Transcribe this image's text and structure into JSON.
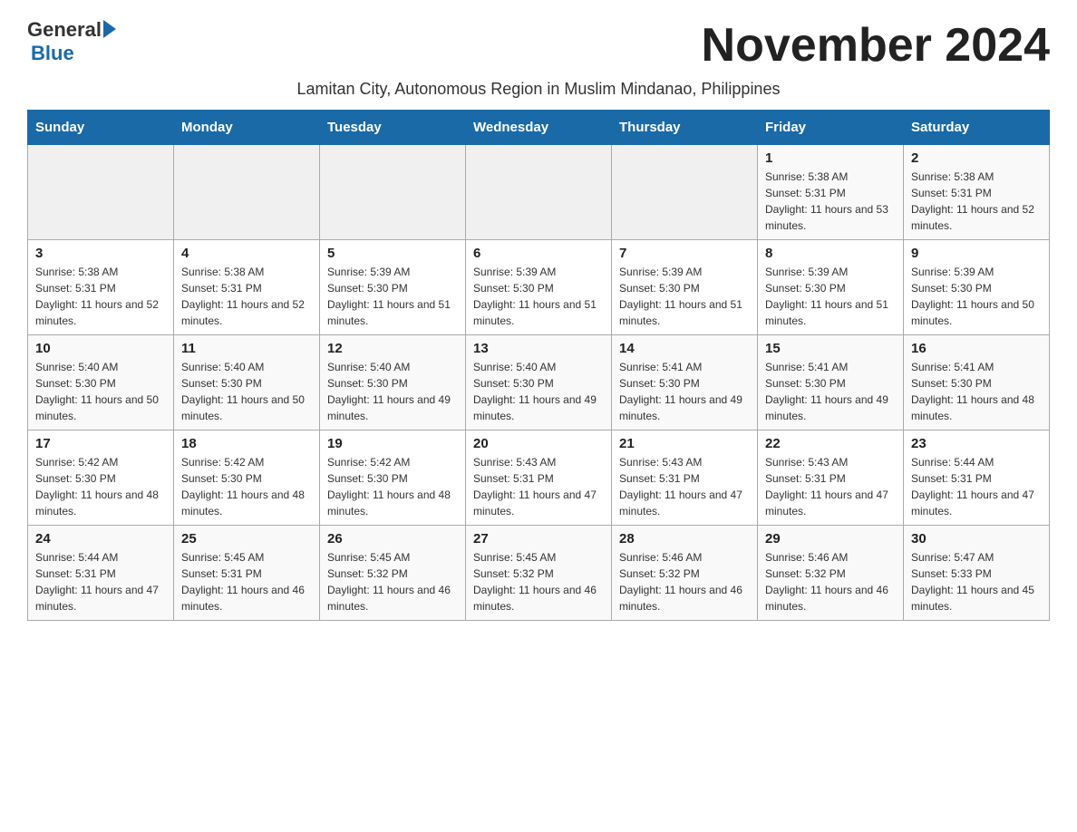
{
  "header": {
    "title": "November 2024",
    "subtitle": "Lamitan City, Autonomous Region in Muslim Mindanao, Philippines",
    "logo_general": "General",
    "logo_blue": "Blue"
  },
  "days_of_week": [
    "Sunday",
    "Monday",
    "Tuesday",
    "Wednesday",
    "Thursday",
    "Friday",
    "Saturday"
  ],
  "weeks": [
    [
      {
        "day": "",
        "sunrise": "",
        "sunset": "",
        "daylight": ""
      },
      {
        "day": "",
        "sunrise": "",
        "sunset": "",
        "daylight": ""
      },
      {
        "day": "",
        "sunrise": "",
        "sunset": "",
        "daylight": ""
      },
      {
        "day": "",
        "sunrise": "",
        "sunset": "",
        "daylight": ""
      },
      {
        "day": "",
        "sunrise": "",
        "sunset": "",
        "daylight": ""
      },
      {
        "day": "1",
        "sunrise": "Sunrise: 5:38 AM",
        "sunset": "Sunset: 5:31 PM",
        "daylight": "Daylight: 11 hours and 53 minutes."
      },
      {
        "day": "2",
        "sunrise": "Sunrise: 5:38 AM",
        "sunset": "Sunset: 5:31 PM",
        "daylight": "Daylight: 11 hours and 52 minutes."
      }
    ],
    [
      {
        "day": "3",
        "sunrise": "Sunrise: 5:38 AM",
        "sunset": "Sunset: 5:31 PM",
        "daylight": "Daylight: 11 hours and 52 minutes."
      },
      {
        "day": "4",
        "sunrise": "Sunrise: 5:38 AM",
        "sunset": "Sunset: 5:31 PM",
        "daylight": "Daylight: 11 hours and 52 minutes."
      },
      {
        "day": "5",
        "sunrise": "Sunrise: 5:39 AM",
        "sunset": "Sunset: 5:30 PM",
        "daylight": "Daylight: 11 hours and 51 minutes."
      },
      {
        "day": "6",
        "sunrise": "Sunrise: 5:39 AM",
        "sunset": "Sunset: 5:30 PM",
        "daylight": "Daylight: 11 hours and 51 minutes."
      },
      {
        "day": "7",
        "sunrise": "Sunrise: 5:39 AM",
        "sunset": "Sunset: 5:30 PM",
        "daylight": "Daylight: 11 hours and 51 minutes."
      },
      {
        "day": "8",
        "sunrise": "Sunrise: 5:39 AM",
        "sunset": "Sunset: 5:30 PM",
        "daylight": "Daylight: 11 hours and 51 minutes."
      },
      {
        "day": "9",
        "sunrise": "Sunrise: 5:39 AM",
        "sunset": "Sunset: 5:30 PM",
        "daylight": "Daylight: 11 hours and 50 minutes."
      }
    ],
    [
      {
        "day": "10",
        "sunrise": "Sunrise: 5:40 AM",
        "sunset": "Sunset: 5:30 PM",
        "daylight": "Daylight: 11 hours and 50 minutes."
      },
      {
        "day": "11",
        "sunrise": "Sunrise: 5:40 AM",
        "sunset": "Sunset: 5:30 PM",
        "daylight": "Daylight: 11 hours and 50 minutes."
      },
      {
        "day": "12",
        "sunrise": "Sunrise: 5:40 AM",
        "sunset": "Sunset: 5:30 PM",
        "daylight": "Daylight: 11 hours and 49 minutes."
      },
      {
        "day": "13",
        "sunrise": "Sunrise: 5:40 AM",
        "sunset": "Sunset: 5:30 PM",
        "daylight": "Daylight: 11 hours and 49 minutes."
      },
      {
        "day": "14",
        "sunrise": "Sunrise: 5:41 AM",
        "sunset": "Sunset: 5:30 PM",
        "daylight": "Daylight: 11 hours and 49 minutes."
      },
      {
        "day": "15",
        "sunrise": "Sunrise: 5:41 AM",
        "sunset": "Sunset: 5:30 PM",
        "daylight": "Daylight: 11 hours and 49 minutes."
      },
      {
        "day": "16",
        "sunrise": "Sunrise: 5:41 AM",
        "sunset": "Sunset: 5:30 PM",
        "daylight": "Daylight: 11 hours and 48 minutes."
      }
    ],
    [
      {
        "day": "17",
        "sunrise": "Sunrise: 5:42 AM",
        "sunset": "Sunset: 5:30 PM",
        "daylight": "Daylight: 11 hours and 48 minutes."
      },
      {
        "day": "18",
        "sunrise": "Sunrise: 5:42 AM",
        "sunset": "Sunset: 5:30 PM",
        "daylight": "Daylight: 11 hours and 48 minutes."
      },
      {
        "day": "19",
        "sunrise": "Sunrise: 5:42 AM",
        "sunset": "Sunset: 5:30 PM",
        "daylight": "Daylight: 11 hours and 48 minutes."
      },
      {
        "day": "20",
        "sunrise": "Sunrise: 5:43 AM",
        "sunset": "Sunset: 5:31 PM",
        "daylight": "Daylight: 11 hours and 47 minutes."
      },
      {
        "day": "21",
        "sunrise": "Sunrise: 5:43 AM",
        "sunset": "Sunset: 5:31 PM",
        "daylight": "Daylight: 11 hours and 47 minutes."
      },
      {
        "day": "22",
        "sunrise": "Sunrise: 5:43 AM",
        "sunset": "Sunset: 5:31 PM",
        "daylight": "Daylight: 11 hours and 47 minutes."
      },
      {
        "day": "23",
        "sunrise": "Sunrise: 5:44 AM",
        "sunset": "Sunset: 5:31 PM",
        "daylight": "Daylight: 11 hours and 47 minutes."
      }
    ],
    [
      {
        "day": "24",
        "sunrise": "Sunrise: 5:44 AM",
        "sunset": "Sunset: 5:31 PM",
        "daylight": "Daylight: 11 hours and 47 minutes."
      },
      {
        "day": "25",
        "sunrise": "Sunrise: 5:45 AM",
        "sunset": "Sunset: 5:31 PM",
        "daylight": "Daylight: 11 hours and 46 minutes."
      },
      {
        "day": "26",
        "sunrise": "Sunrise: 5:45 AM",
        "sunset": "Sunset: 5:32 PM",
        "daylight": "Daylight: 11 hours and 46 minutes."
      },
      {
        "day": "27",
        "sunrise": "Sunrise: 5:45 AM",
        "sunset": "Sunset: 5:32 PM",
        "daylight": "Daylight: 11 hours and 46 minutes."
      },
      {
        "day": "28",
        "sunrise": "Sunrise: 5:46 AM",
        "sunset": "Sunset: 5:32 PM",
        "daylight": "Daylight: 11 hours and 46 minutes."
      },
      {
        "day": "29",
        "sunrise": "Sunrise: 5:46 AM",
        "sunset": "Sunset: 5:32 PM",
        "daylight": "Daylight: 11 hours and 46 minutes."
      },
      {
        "day": "30",
        "sunrise": "Sunrise: 5:47 AM",
        "sunset": "Sunset: 5:33 PM",
        "daylight": "Daylight: 11 hours and 45 minutes."
      }
    ]
  ]
}
